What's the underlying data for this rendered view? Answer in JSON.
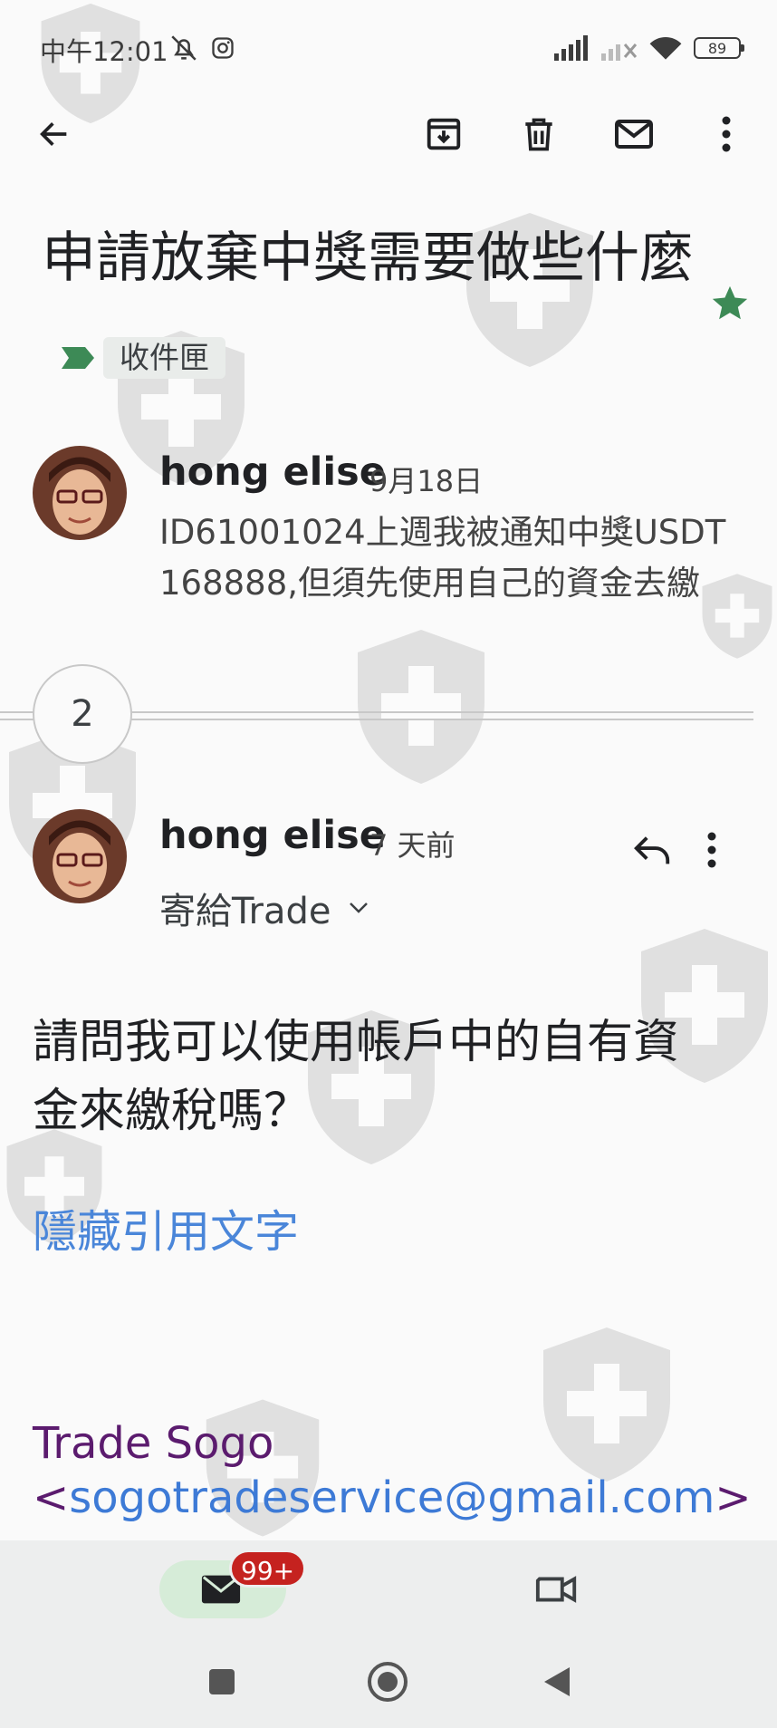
{
  "status_bar": {
    "time": "中午12:01",
    "battery": "89"
  },
  "toolbar": {
    "back_icon": "arrow-left-icon",
    "archive_icon": "archive-icon",
    "delete_icon": "trash-icon",
    "mark_unread_icon": "mail-icon",
    "more_icon": "more-vert-icon"
  },
  "email": {
    "subject": "申請放棄中獎需要做些什麼",
    "label": "收件匣",
    "starred": true
  },
  "collapsed_message": {
    "sender": "hong elise",
    "date": "9月18日",
    "snippet_line1": "ID61001024上週我被通知中獎USDT",
    "snippet_line2": "168888,但須先使用自己的資金去繳"
  },
  "thread_count": "2",
  "expanded_message": {
    "sender": "hong elise",
    "date": "7 天前",
    "recipient": "寄給Trade",
    "body_line1": "請問我可以使用帳戶中的自有資",
    "body_line2": "金來繳稅嗎？",
    "hide_quoted": "隱藏引用文字",
    "signature_name": "Trade Sogo",
    "signature_lt": "<",
    "signature_email": "sogotradeservice@gmail.com",
    "signature_gt": ">"
  },
  "bottom_nav": {
    "mail_badge": "99+"
  },
  "colors": {
    "star": "#3d8a56",
    "link": "#4a86d9",
    "signature": "#5b1b6e",
    "badge": "#c5221f",
    "pill": "#d6ecd8"
  }
}
